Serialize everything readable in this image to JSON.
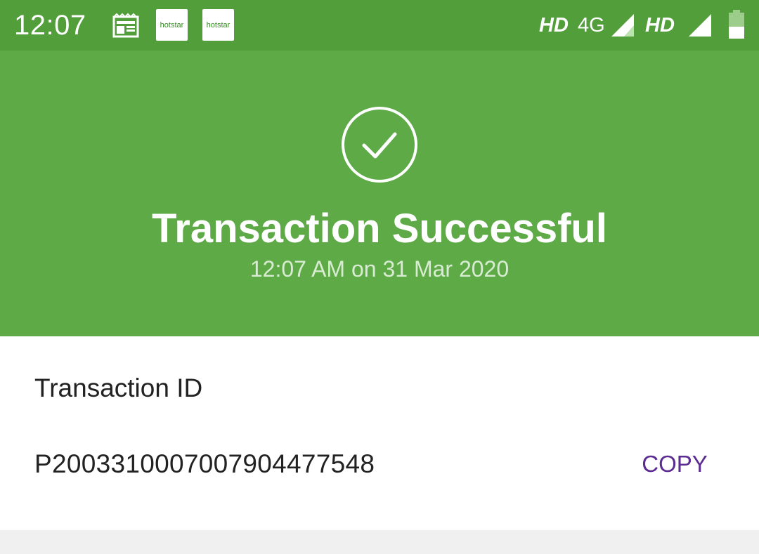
{
  "status_bar": {
    "time": "12:07",
    "notification_apps": [
      "hotstar",
      "hotstar"
    ],
    "network_hd_1": "HD",
    "network_type": "4G",
    "network_hd_2": "HD",
    "icons": [
      "news-icon",
      "signal-icon",
      "battery-icon"
    ]
  },
  "transaction": {
    "status_title": "Transaction Successful",
    "timestamp": "12:07 AM on 31 Mar 2020",
    "id_label": "Transaction ID",
    "id_value": "P2003310007007904477548",
    "copy_label": "COPY"
  },
  "colors": {
    "status_bar": "#529e3b",
    "hero": "#5eaa47",
    "copy_accent": "#5c2d91"
  }
}
